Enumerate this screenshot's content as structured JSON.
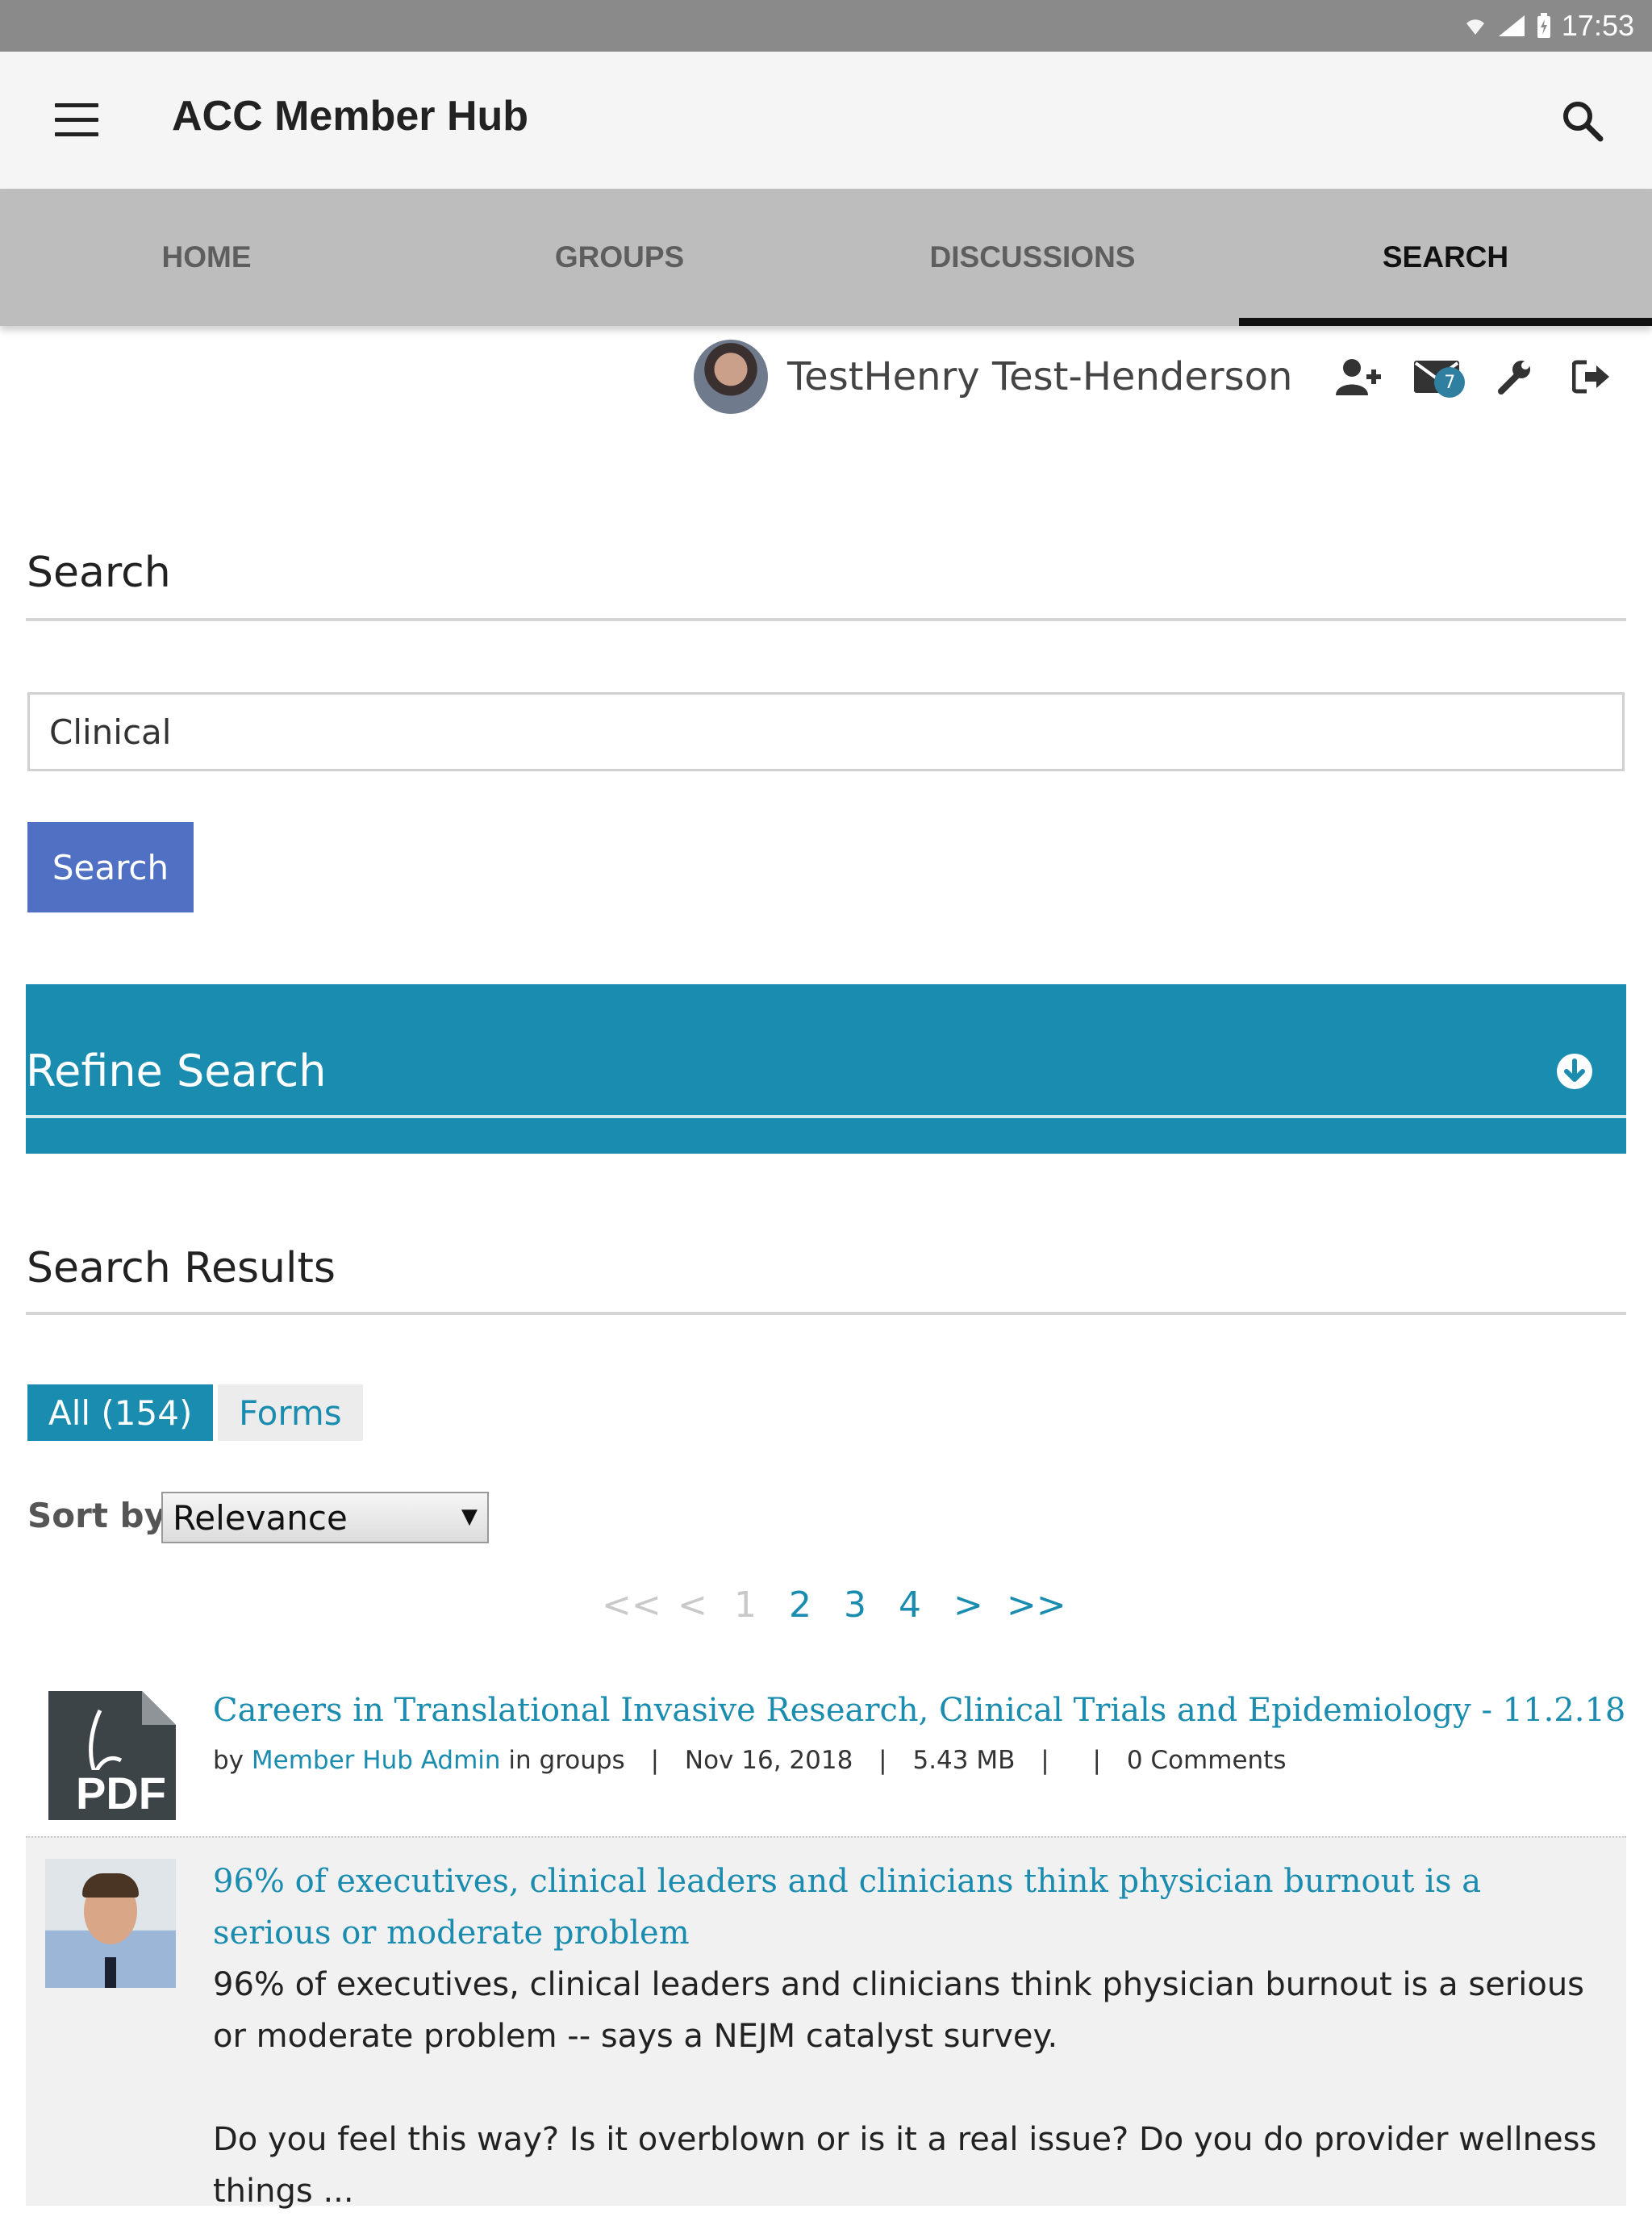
{
  "status_bar": {
    "time": "17:53"
  },
  "app_bar": {
    "title": "ACC Member Hub"
  },
  "tabs": [
    {
      "label": "HOME",
      "active": false
    },
    {
      "label": "GROUPS",
      "active": false
    },
    {
      "label": "DISCUSSIONS",
      "active": false
    },
    {
      "label": "SEARCH",
      "active": true
    }
  ],
  "user": {
    "name": "TestHenry Test-Henderson",
    "messages_badge": "7"
  },
  "search": {
    "heading": "Search",
    "query": "Clinical",
    "button_label": "Search"
  },
  "refine": {
    "label": "Refine Search"
  },
  "results": {
    "heading": "Search Results",
    "filters": [
      {
        "label": "All (154)",
        "active": true
      },
      {
        "label": "Forms",
        "active": false
      }
    ],
    "sort": {
      "label": "Sort by:",
      "selected": "Relevance"
    },
    "pager": {
      "first": "<<",
      "prev": "<",
      "pages": [
        "1",
        "2",
        "3",
        "4"
      ],
      "current": "1",
      "next": ">",
      "last": ">>"
    },
    "items": [
      {
        "icon": "pdf-file-icon",
        "title": "Careers in Translational Invasive Research, Clinical Trials and Epidemiology - 11.2.18",
        "by": "by",
        "author": "Member Hub Admin",
        "in_text": "in groups",
        "date": "Nov 16, 2018",
        "size": "5.43 MB",
        "comments": "0 Comments"
      },
      {
        "icon": "author-photo",
        "title": "96% of executives, clinical leaders and clinicians think physician burnout is a serious or moderate problem",
        "snippet1": "96% of executives, clinical leaders and clinicians think physician burnout is a serious or moderate problem -- says a NEJM catalyst survey.",
        "snippet2": "Do you feel this way? Is it overblown or is it a real issue? Do you do provider wellness things ..."
      }
    ]
  },
  "colors": {
    "accent": "#1a8cb0",
    "button": "#5070c4",
    "tab_bar": "#bdbdbd"
  }
}
